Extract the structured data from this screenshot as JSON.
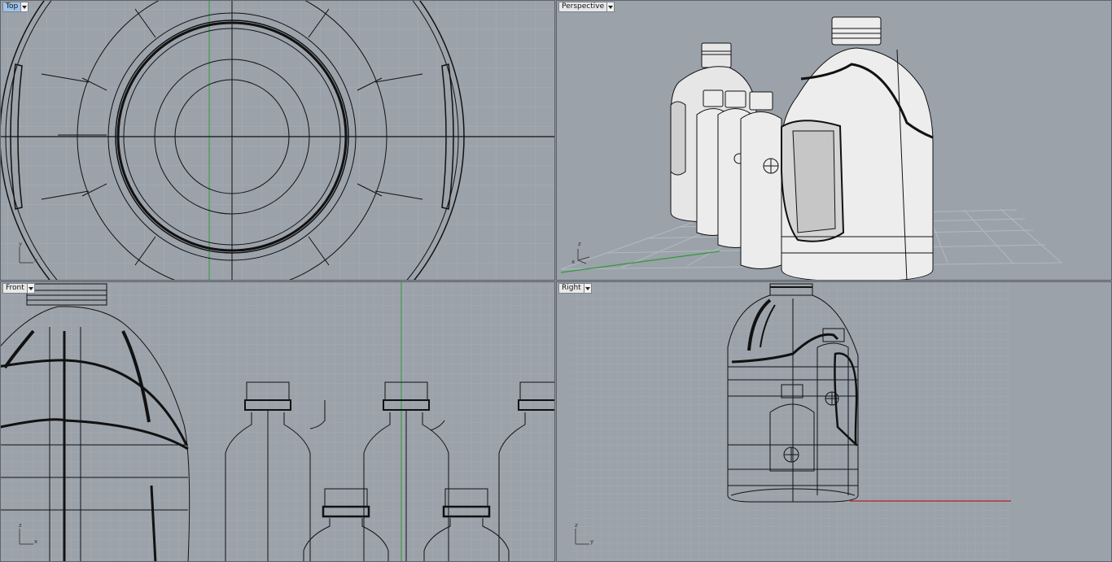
{
  "viewports": {
    "top": {
      "title": "Top",
      "active": true,
      "axis_v": "y",
      "axis_h": "x"
    },
    "perspective": {
      "title": "Perspective",
      "active": false,
      "axis_v": "z",
      "axis_h": "x"
    },
    "front": {
      "title": "Front",
      "active": false,
      "axis_v": "z",
      "axis_h": "x"
    },
    "right": {
      "title": "Right",
      "active": false,
      "axis_v": "z",
      "axis_h": "y"
    }
  },
  "icons": {
    "viewport_menu": "chevron-down-icon",
    "axis": "axis-triad-icon"
  },
  "colors": {
    "viewport_bg": "#9ba2aa",
    "grid_minor": "#a6adb5",
    "grid_major": "#8c939b",
    "x_axis": "#b42323",
    "y_axis": "#2f9a3a",
    "wire": "#111111",
    "shaded_surface": "#e9e9e9",
    "active_tab": "#9fc3ea"
  }
}
